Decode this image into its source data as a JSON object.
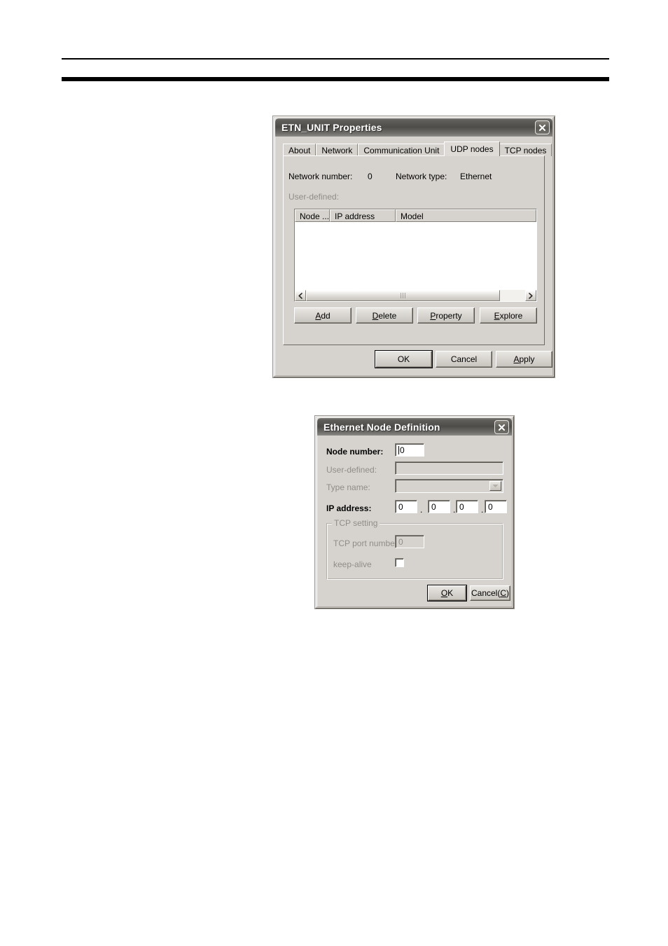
{
  "page": {
    "background": "#ffffff",
    "rules": {
      "thin_label": "header-rule-thin",
      "thick_label": "header-rule-thick"
    }
  },
  "dialog1": {
    "title": "ETN_UNIT Properties",
    "close_icon": "close-icon",
    "tabs": [
      {
        "label": "About",
        "active": false
      },
      {
        "label": "Network",
        "active": false
      },
      {
        "label": "Communication Unit",
        "active": false
      },
      {
        "label": "UDP nodes",
        "active": true
      },
      {
        "label": "TCP nodes",
        "active": false
      }
    ],
    "info": {
      "network_number_label": "Network number:",
      "network_number_value": "0",
      "network_type_label": "Network type:",
      "network_type_value": "Ethernet"
    },
    "user_defined_label": "User-defined:",
    "list": {
      "columns": [
        "Node ...",
        "IP address",
        "Model"
      ],
      "rows": []
    },
    "scrollbar": {
      "left_arrow_icon": "chevron-left-icon",
      "right_arrow_icon": "chevron-right-icon"
    },
    "list_buttons": [
      {
        "label": "Add",
        "accel": "A"
      },
      {
        "label": "Delete",
        "accel": "D"
      },
      {
        "label": "Property",
        "accel": "P"
      },
      {
        "label": "Explore",
        "accel": "E"
      }
    ],
    "footer_buttons": [
      {
        "label": "OK",
        "default": true
      },
      {
        "label": "Cancel",
        "default": false
      },
      {
        "label": "Apply",
        "accel": "A",
        "default": false
      }
    ]
  },
  "dialog2": {
    "title": "Ethernet Node Definition",
    "close_icon": "close-icon",
    "fields": {
      "node_number_label": "Node number:",
      "node_number_value": "0",
      "user_defined_label": "User-defined:",
      "user_defined_value": "",
      "type_name_label": "Type name:",
      "type_name_value": "",
      "ip_address_label": "IP address:",
      "ip_octets": [
        "0",
        "0",
        "0",
        "0"
      ],
      "ip_separator": "."
    },
    "tcp_group": {
      "legend": "TCP setting",
      "port_label": "TCP port number",
      "port_value": "0",
      "keep_alive_label": "keep-alive",
      "keep_alive_checked": false
    },
    "buttons": [
      {
        "label": "OK",
        "accel": "O",
        "default": true
      },
      {
        "label": "Cancel(C)",
        "accel": "C",
        "default": false
      }
    ]
  }
}
